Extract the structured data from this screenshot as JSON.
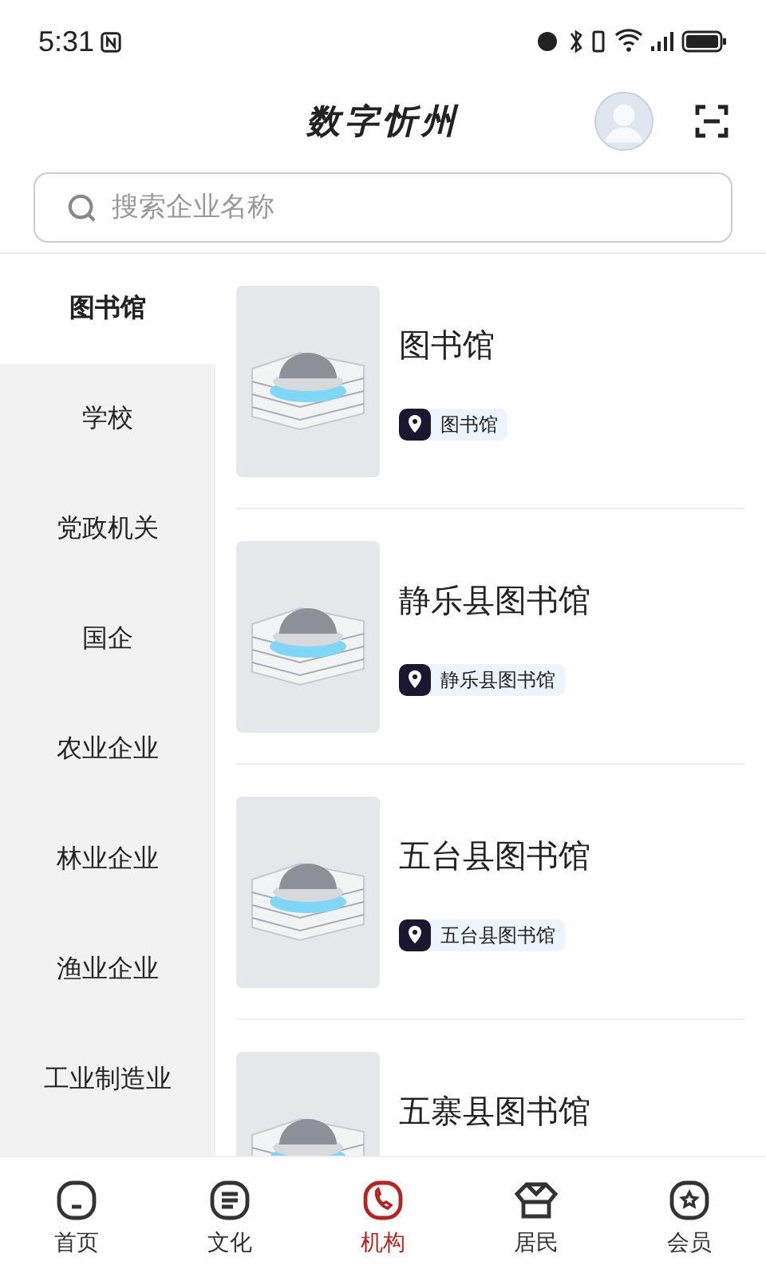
{
  "status_bar": {
    "time": "5:31"
  },
  "header": {
    "title": "数字忻州"
  },
  "search": {
    "placeholder": "搜索企业名称"
  },
  "sidebar": {
    "items": [
      {
        "label": "图书馆",
        "selected": true
      },
      {
        "label": "学校",
        "selected": false
      },
      {
        "label": "党政机关",
        "selected": false
      },
      {
        "label": "国企",
        "selected": false
      },
      {
        "label": "农业企业",
        "selected": false
      },
      {
        "label": "林业企业",
        "selected": false
      },
      {
        "label": "渔业企业",
        "selected": false
      },
      {
        "label": "工业制造业",
        "selected": false
      }
    ]
  },
  "list": [
    {
      "title": "图书馆",
      "tag": "图书馆"
    },
    {
      "title": "静乐县图书馆",
      "tag": "静乐县图书馆"
    },
    {
      "title": "五台县图书馆",
      "tag": "五台县图书馆"
    },
    {
      "title": "五寨县图书馆"
    }
  ],
  "tab_bar": [
    {
      "label": "首页",
      "kind": "home",
      "selected": false
    },
    {
      "label": "文化",
      "kind": "culture",
      "selected": false
    },
    {
      "label": "机构",
      "kind": "org",
      "selected": true
    },
    {
      "label": "居民",
      "kind": "resident",
      "selected": false
    },
    {
      "label": "会员",
      "kind": "member",
      "selected": false
    }
  ]
}
